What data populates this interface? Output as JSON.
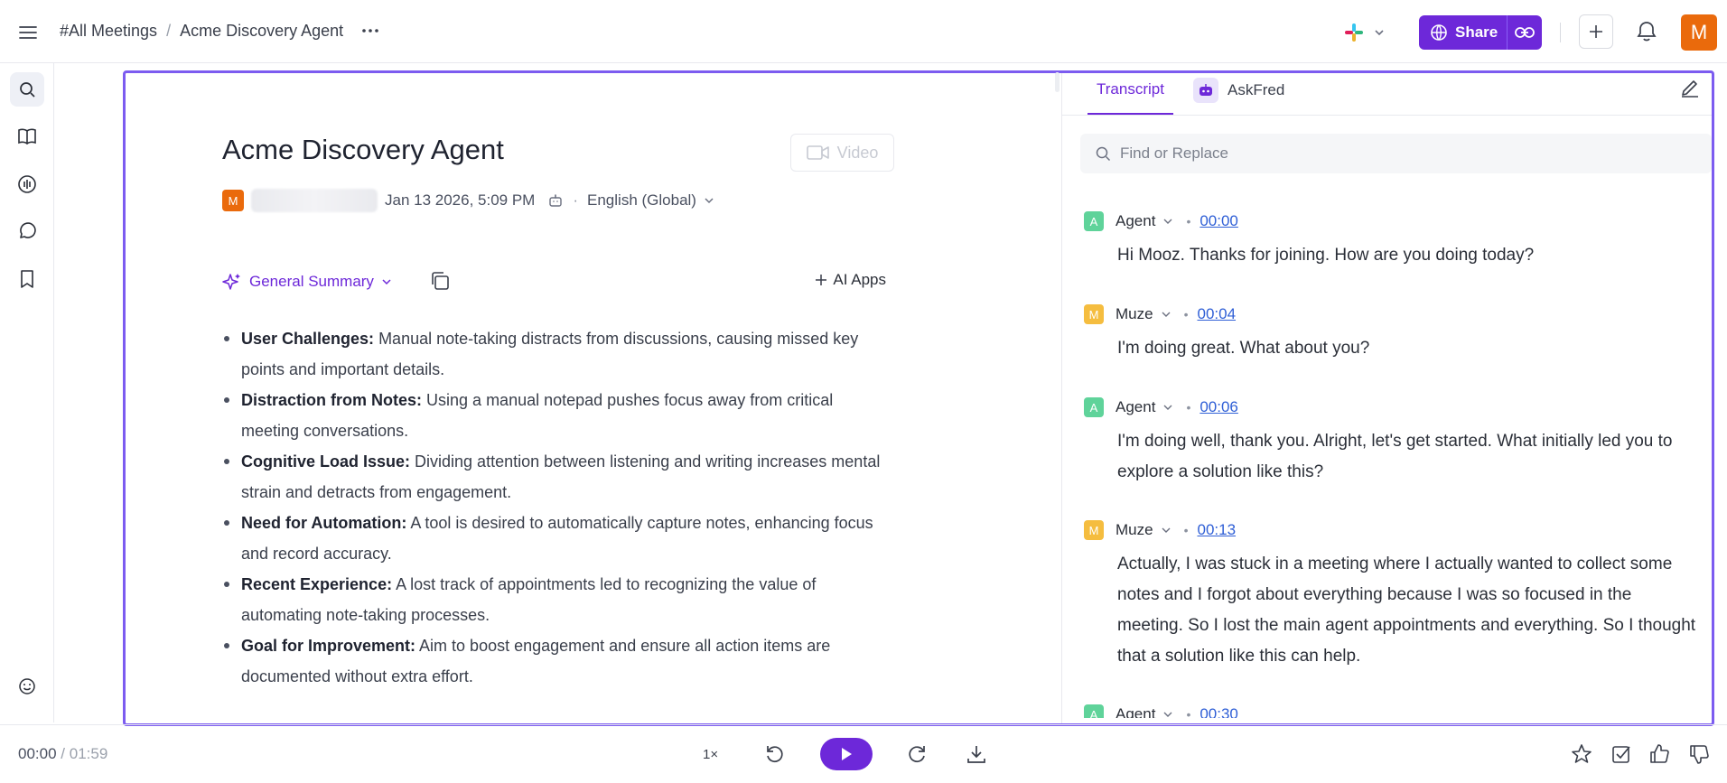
{
  "header": {
    "breadcrumb_root": "#All Meetings",
    "breadcrumb_sep": "/",
    "breadcrumb_current": "Acme Discovery Agent",
    "share_label": "Share",
    "user_initial": "M"
  },
  "meeting": {
    "title": "Acme Discovery Agent",
    "video_label": "Video",
    "owner_initial": "M",
    "date": "Jan 13 2026, 5:09 PM",
    "language": "English (Global)"
  },
  "summary": {
    "selector_label": "General Summary",
    "ai_apps_label": "AI Apps",
    "items": [
      {
        "title": "User Challenges:",
        "text": " Manual note-taking distracts from discussions, causing missed key points and important details."
      },
      {
        "title": "Distraction from Notes:",
        "text": " Using a manual notepad pushes focus away from critical meeting conversations."
      },
      {
        "title": "Cognitive Load Issue:",
        "text": " Dividing attention between listening and writing increases mental strain and detracts from engagement."
      },
      {
        "title": "Need for Automation:",
        "text": " A tool is desired to automatically capture notes, enhancing focus and record accuracy."
      },
      {
        "title": "Recent Experience:",
        "text": " A lost track of appointments led to recognizing the value of automating note-taking processes."
      },
      {
        "title": "Goal for Improvement:",
        "text": " Aim to boost engagement and ensure all action items are documented without extra effort."
      }
    ]
  },
  "panel": {
    "tab_transcript": "Transcript",
    "tab_askfred": "AskFred",
    "find_placeholder": "Find or Replace"
  },
  "transcript": [
    {
      "initial": "A",
      "speaker": "Agent",
      "time": "00:00",
      "text": "Hi Mooz. Thanks for joining. How are you doing today?",
      "color": "#5fd39a"
    },
    {
      "initial": "M",
      "speaker": "Muze",
      "time": "00:04",
      "text": "I'm doing great. What about you?",
      "color": "#f5bd3f"
    },
    {
      "initial": "A",
      "speaker": "Agent",
      "time": "00:06",
      "text": "I'm doing well, thank you. Alright, let's get started. What initially led you to explore a solution like this?",
      "color": "#5fd39a"
    },
    {
      "initial": "M",
      "speaker": "Muze",
      "time": "00:13",
      "text": "Actually, I was stuck in a meeting where I actually wanted to collect some notes and I forgot about everything because I was so focused in the meeting. So I lost the main agent appointments and everything. So I thought that a solution like this can help.",
      "color": "#f5bd3f"
    },
    {
      "initial": "A",
      "speaker": "Agent",
      "time": "00:30",
      "text": "",
      "color": "#5fd39a"
    }
  ],
  "player": {
    "current": "00:00",
    "sep": "/",
    "total": "01:59",
    "speed": "1×"
  },
  "colors": {
    "accent": "#6d28d9",
    "avatar": "#ea6a0c",
    "frame": "#7c5cf0"
  }
}
